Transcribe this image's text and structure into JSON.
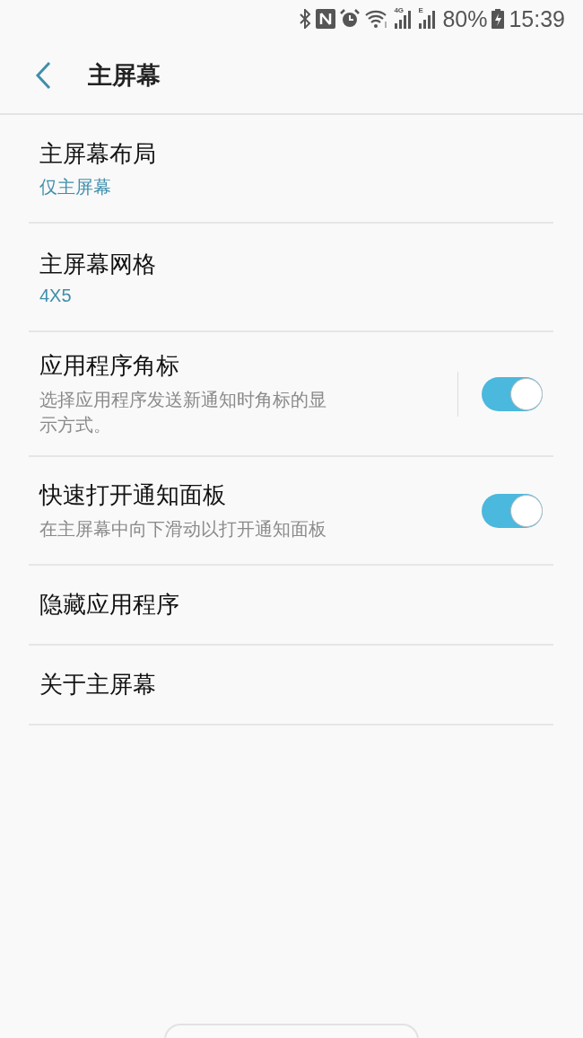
{
  "status_bar": {
    "network_labels": [
      "4G",
      "E"
    ],
    "battery": "80%",
    "time": "15:39"
  },
  "header": {
    "title": "主屏幕"
  },
  "items": [
    {
      "kind": "value",
      "title": "主屏幕布局",
      "value": "仅主屏幕"
    },
    {
      "kind": "value",
      "title": "主屏幕网格",
      "value": "4X5"
    },
    {
      "kind": "switch",
      "title": "应用程序角标",
      "description": "选择应用程序发送新通知时角标的显示方式。",
      "on": true,
      "divider": true
    },
    {
      "kind": "switch",
      "title": "快速打开通知面板",
      "description": "在主屏幕中向下滑动以打开通知面板",
      "on": true,
      "divider": false
    },
    {
      "kind": "plain",
      "title": "隐藏应用程序"
    },
    {
      "kind": "plain",
      "title": "关于主屏幕"
    }
  ]
}
